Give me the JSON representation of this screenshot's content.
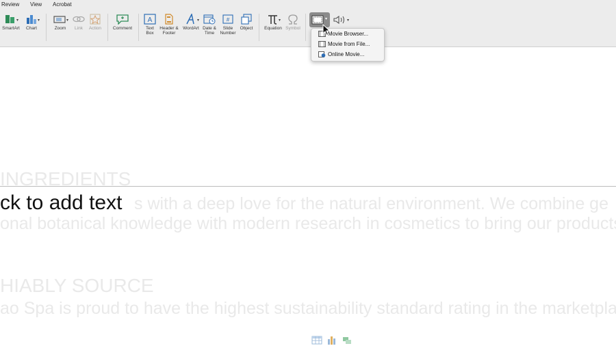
{
  "menubar": {
    "review": "Review",
    "view": "View",
    "acrobat": "Acrobat"
  },
  "ribbon": {
    "smartart": "SmartArt",
    "chart": "Chart",
    "zoom": "Zoom",
    "link": "Link",
    "action": "Action",
    "comment": "Comment",
    "textbox": [
      "Text",
      "Box"
    ],
    "header_footer": [
      "Header &",
      "Footer"
    ],
    "wordart": "WordArt",
    "date_time": [
      "Date &",
      "Time"
    ],
    "slide_number": [
      "Slide",
      "Number"
    ],
    "object": "Object",
    "equation": "Equation",
    "symbol": "Symbol"
  },
  "video_menu": {
    "items": [
      "Movie Browser...",
      "Movie from File...",
      "Online Movie..."
    ]
  },
  "slide": {
    "placeholder": "ck to add text",
    "ghost_heading_1": "INGREDIENTS",
    "ghost_line_1": "s with a deep love for the natural environment. We combine ge",
    "ghost_line_2": "onal botanical knowledge with modern research in cosmetics to bring our products",
    "ghost_heading_2": "HIABLY SOURCE",
    "ghost_line_3": "ao Spa is proud to have the highest sustainability standard rating in the marketplac"
  },
  "colors": {
    "ribbon_bg": "#ececec",
    "accent_blue": "#2d6db5",
    "menu_bg": "#f4f4f4"
  }
}
